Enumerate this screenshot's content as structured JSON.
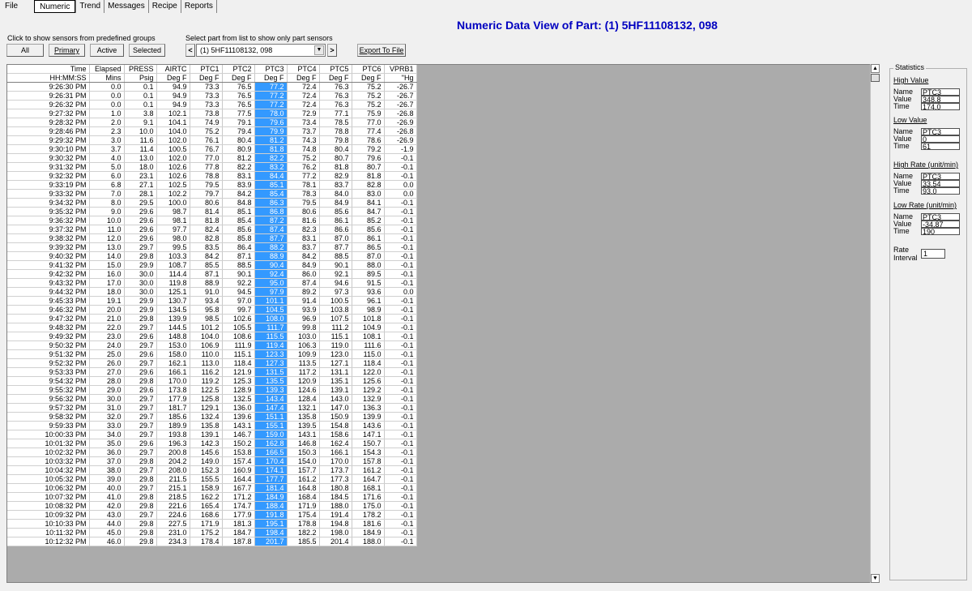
{
  "menu": {
    "file": "File",
    "tabs": [
      "Numeric",
      "Trend",
      "Messages",
      "Recipe",
      "Reports"
    ]
  },
  "title": "Numeric Data View of Part: (1) 5HF11108132, 098",
  "groups": {
    "label": "Click to show sensors from predefined groups",
    "all": "All",
    "primary": "Primary",
    "active": "Active",
    "selected": "Selected"
  },
  "part_select": {
    "label": "Select part from list to show only part sensors",
    "prev": "<",
    "value": "(1) 5HF11108132, 098",
    "next": ">"
  },
  "export": "Export To File",
  "table": {
    "headers1": [
      "Time",
      "Elapsed",
      "PRESS",
      "AIRTC",
      "PTC1",
      "PTC2",
      "PTC3",
      "PTC4",
      "PTC5",
      "PTC6",
      "VPRB1"
    ],
    "headers2": [
      "HH:MM:SS",
      "Mins",
      "Psig",
      "Deg F",
      "Deg F",
      "Deg F",
      "Deg F",
      "Deg F",
      "Deg F",
      "Deg F",
      "\"Hg"
    ],
    "selected_column": 6,
    "rows": [
      [
        "9:26:30 PM",
        "0.0",
        "0.1",
        "94.9",
        "73.3",
        "76.5",
        "77.2",
        "72.4",
        "76.3",
        "75.2",
        "-26.7"
      ],
      [
        "9:26:31 PM",
        "0.0",
        "0.1",
        "94.9",
        "73.3",
        "76.5",
        "77.2",
        "72.4",
        "76.3",
        "75.2",
        "-26.7"
      ],
      [
        "9:26:32 PM",
        "0.0",
        "0.1",
        "94.9",
        "73.3",
        "76.5",
        "77.2",
        "72.4",
        "76.3",
        "75.2",
        "-26.7"
      ],
      [
        "9:27:32 PM",
        "1.0",
        "3.8",
        "102.1",
        "73.8",
        "77.5",
        "78.0",
        "72.9",
        "77.1",
        "75.9",
        "-26.8"
      ],
      [
        "9:28:32 PM",
        "2.0",
        "9.1",
        "104.1",
        "74.9",
        "79.1",
        "79.6",
        "73.4",
        "78.5",
        "77.0",
        "-26.9"
      ],
      [
        "9:28:46 PM",
        "2.3",
        "10.0",
        "104.0",
        "75.2",
        "79.4",
        "79.9",
        "73.7",
        "78.8",
        "77.4",
        "-26.8"
      ],
      [
        "9:29:32 PM",
        "3.0",
        "11.6",
        "102.0",
        "76.1",
        "80.4",
        "81.2",
        "74.3",
        "79.8",
        "78.6",
        "-26.9"
      ],
      [
        "9:30:10 PM",
        "3.7",
        "11.4",
        "100.5",
        "76.7",
        "80.9",
        "81.8",
        "74.8",
        "80.4",
        "79.2",
        "-1.9"
      ],
      [
        "9:30:32 PM",
        "4.0",
        "13.0",
        "102.0",
        "77.0",
        "81.2",
        "82.2",
        "75.2",
        "80.7",
        "79.6",
        "-0.1"
      ],
      [
        "9:31:32 PM",
        "5.0",
        "18.0",
        "102.6",
        "77.8",
        "82.2",
        "83.2",
        "76.2",
        "81.8",
        "80.7",
        "-0.1"
      ],
      [
        "9:32:32 PM",
        "6.0",
        "23.1",
        "102.6",
        "78.8",
        "83.1",
        "84.4",
        "77.2",
        "82.9",
        "81.8",
        "-0.1"
      ],
      [
        "9:33:19 PM",
        "6.8",
        "27.1",
        "102.5",
        "79.5",
        "83.9",
        "85.1",
        "78.1",
        "83.7",
        "82.8",
        "0.0"
      ],
      [
        "9:33:32 PM",
        "7.0",
        "28.1",
        "102.2",
        "79.7",
        "84.2",
        "85.4",
        "78.3",
        "84.0",
        "83.0",
        "0.0"
      ],
      [
        "9:34:32 PM",
        "8.0",
        "29.5",
        "100.0",
        "80.6",
        "84.8",
        "86.3",
        "79.5",
        "84.9",
        "84.1",
        "-0.1"
      ],
      [
        "9:35:32 PM",
        "9.0",
        "29.6",
        "98.7",
        "81.4",
        "85.1",
        "86.8",
        "80.6",
        "85.6",
        "84.7",
        "-0.1"
      ],
      [
        "9:36:32 PM",
        "10.0",
        "29.6",
        "98.1",
        "81.8",
        "85.4",
        "87.2",
        "81.6",
        "86.1",
        "85.2",
        "-0.1"
      ],
      [
        "9:37:32 PM",
        "11.0",
        "29.6",
        "97.7",
        "82.4",
        "85.6",
        "87.4",
        "82.3",
        "86.6",
        "85.6",
        "-0.1"
      ],
      [
        "9:38:32 PM",
        "12.0",
        "29.6",
        "98.0",
        "82.8",
        "85.8",
        "87.7",
        "83.1",
        "87.0",
        "86.1",
        "-0.1"
      ],
      [
        "9:39:32 PM",
        "13.0",
        "29.7",
        "99.5",
        "83.5",
        "86.4",
        "88.2",
        "83.7",
        "87.7",
        "86.5",
        "-0.1"
      ],
      [
        "9:40:32 PM",
        "14.0",
        "29.8",
        "103.3",
        "84.2",
        "87.1",
        "88.9",
        "84.2",
        "88.5",
        "87.0",
        "-0.1"
      ],
      [
        "9:41:32 PM",
        "15.0",
        "29.9",
        "108.7",
        "85.5",
        "88.5",
        "90.4",
        "84.9",
        "90.1",
        "88.0",
        "-0.1"
      ],
      [
        "9:42:32 PM",
        "16.0",
        "30.0",
        "114.4",
        "87.1",
        "90.1",
        "92.4",
        "86.0",
        "92.1",
        "89.5",
        "-0.1"
      ],
      [
        "9:43:32 PM",
        "17.0",
        "30.0",
        "119.8",
        "88.9",
        "92.2",
        "95.0",
        "87.4",
        "94.6",
        "91.5",
        "-0.1"
      ],
      [
        "9:44:32 PM",
        "18.0",
        "30.0",
        "125.1",
        "91.0",
        "94.5",
        "97.9",
        "89.2",
        "97.3",
        "93.6",
        "0.0"
      ],
      [
        "9:45:33 PM",
        "19.1",
        "29.9",
        "130.7",
        "93.4",
        "97.0",
        "101.1",
        "91.4",
        "100.5",
        "96.1",
        "-0.1"
      ],
      [
        "9:46:32 PM",
        "20.0",
        "29.9",
        "134.5",
        "95.8",
        "99.7",
        "104.5",
        "93.9",
        "103.8",
        "98.9",
        "-0.1"
      ],
      [
        "9:47:32 PM",
        "21.0",
        "29.8",
        "139.9",
        "98.5",
        "102.6",
        "108.0",
        "96.9",
        "107.5",
        "101.8",
        "-0.1"
      ],
      [
        "9:48:32 PM",
        "22.0",
        "29.7",
        "144.5",
        "101.2",
        "105.5",
        "111.7",
        "99.8",
        "111.2",
        "104.9",
        "-0.1"
      ],
      [
        "9:49:32 PM",
        "23.0",
        "29.6",
        "148.8",
        "104.0",
        "108.6",
        "115.5",
        "103.0",
        "115.1",
        "108.1",
        "-0.1"
      ],
      [
        "9:50:32 PM",
        "24.0",
        "29.7",
        "153.0",
        "106.9",
        "111.9",
        "119.4",
        "106.3",
        "119.0",
        "111.6",
        "-0.1"
      ],
      [
        "9:51:32 PM",
        "25.0",
        "29.6",
        "158.0",
        "110.0",
        "115.1",
        "123.3",
        "109.9",
        "123.0",
        "115.0",
        "-0.1"
      ],
      [
        "9:52:32 PM",
        "26.0",
        "29.7",
        "162.1",
        "113.0",
        "118.4",
        "127.3",
        "113.5",
        "127.1",
        "118.4",
        "-0.1"
      ],
      [
        "9:53:33 PM",
        "27.0",
        "29.6",
        "166.1",
        "116.2",
        "121.9",
        "131.5",
        "117.2",
        "131.1",
        "122.0",
        "-0.1"
      ],
      [
        "9:54:32 PM",
        "28.0",
        "29.8",
        "170.0",
        "119.2",
        "125.3",
        "135.5",
        "120.9",
        "135.1",
        "125.6",
        "-0.1"
      ],
      [
        "9:55:32 PM",
        "29.0",
        "29.6",
        "173.8",
        "122.5",
        "128.9",
        "139.3",
        "124.6",
        "139.1",
        "129.2",
        "-0.1"
      ],
      [
        "9:56:32 PM",
        "30.0",
        "29.7",
        "177.9",
        "125.8",
        "132.5",
        "143.4",
        "128.4",
        "143.0",
        "132.9",
        "-0.1"
      ],
      [
        "9:57:32 PM",
        "31.0",
        "29.7",
        "181.7",
        "129.1",
        "136.0",
        "147.4",
        "132.1",
        "147.0",
        "136.3",
        "-0.1"
      ],
      [
        "9:58:32 PM",
        "32.0",
        "29.7",
        "185.6",
        "132.4",
        "139.6",
        "151.1",
        "135.8",
        "150.9",
        "139.9",
        "-0.1"
      ],
      [
        "9:59:33 PM",
        "33.0",
        "29.7",
        "189.9",
        "135.8",
        "143.1",
        "155.1",
        "139.5",
        "154.8",
        "143.6",
        "-0.1"
      ],
      [
        "10:00:33 PM",
        "34.0",
        "29.7",
        "193.8",
        "139.1",
        "146.7",
        "159.0",
        "143.1",
        "158.6",
        "147.1",
        "-0.1"
      ],
      [
        "10:01:32 PM",
        "35.0",
        "29.6",
        "196.3",
        "142.3",
        "150.2",
        "162.8",
        "146.8",
        "162.4",
        "150.7",
        "-0.1"
      ],
      [
        "10:02:32 PM",
        "36.0",
        "29.7",
        "200.8",
        "145.6",
        "153.8",
        "166.5",
        "150.3",
        "166.1",
        "154.3",
        "-0.1"
      ],
      [
        "10:03:32 PM",
        "37.0",
        "29.8",
        "204.2",
        "149.0",
        "157.4",
        "170.4",
        "154.0",
        "170.0",
        "157.8",
        "-0.1"
      ],
      [
        "10:04:32 PM",
        "38.0",
        "29.7",
        "208.0",
        "152.3",
        "160.9",
        "174.1",
        "157.7",
        "173.7",
        "161.2",
        "-0.1"
      ],
      [
        "10:05:32 PM",
        "39.0",
        "29.8",
        "211.5",
        "155.5",
        "164.4",
        "177.7",
        "161.2",
        "177.3",
        "164.7",
        "-0.1"
      ],
      [
        "10:06:32 PM",
        "40.0",
        "29.7",
        "215.1",
        "158.9",
        "167.7",
        "181.4",
        "164.8",
        "180.8",
        "168.1",
        "-0.1"
      ],
      [
        "10:07:32 PM",
        "41.0",
        "29.8",
        "218.5",
        "162.2",
        "171.2",
        "184.9",
        "168.4",
        "184.5",
        "171.6",
        "-0.1"
      ],
      [
        "10:08:32 PM",
        "42.0",
        "29.8",
        "221.6",
        "165.4",
        "174.7",
        "188.4",
        "171.9",
        "188.0",
        "175.0",
        "-0.1"
      ],
      [
        "10:09:32 PM",
        "43.0",
        "29.7",
        "224.6",
        "168.6",
        "177.9",
        "191.8",
        "175.4",
        "191.4",
        "178.2",
        "-0.1"
      ],
      [
        "10:10:33 PM",
        "44.0",
        "29.8",
        "227.5",
        "171.9",
        "181.3",
        "195.1",
        "178.8",
        "194.8",
        "181.6",
        "-0.1"
      ],
      [
        "10:11:32 PM",
        "45.0",
        "29.8",
        "231.0",
        "175.2",
        "184.7",
        "198.4",
        "182.2",
        "198.0",
        "184.9",
        "-0.1"
      ],
      [
        "10:12:32 PM",
        "46.0",
        "29.8",
        "234.3",
        "178.4",
        "187.8",
        "201.7",
        "185.5",
        "201.4",
        "188.0",
        "-0.1"
      ]
    ]
  },
  "statistics": {
    "title": "Statistics",
    "labels": {
      "name": "Name",
      "value": "Value",
      "time": "Time"
    },
    "high_value": {
      "heading": "High Value",
      "name": "PTC3",
      "value": "348.8",
      "time": "174.0"
    },
    "low_value": {
      "heading": "Low Value",
      "name": "PTC3",
      "value": "0",
      "time": "61"
    },
    "high_rate": {
      "heading": "High Rate (unit/min)",
      "name": "PTC3",
      "value": "33.54",
      "time": "93.0"
    },
    "low_rate": {
      "heading": "Low Rate (unit/min)",
      "name": "PTC3",
      "value": "-34.87",
      "time": "190"
    },
    "rate_interval": {
      "label1": "Rate",
      "label2": "Interval",
      "value": "1"
    }
  }
}
